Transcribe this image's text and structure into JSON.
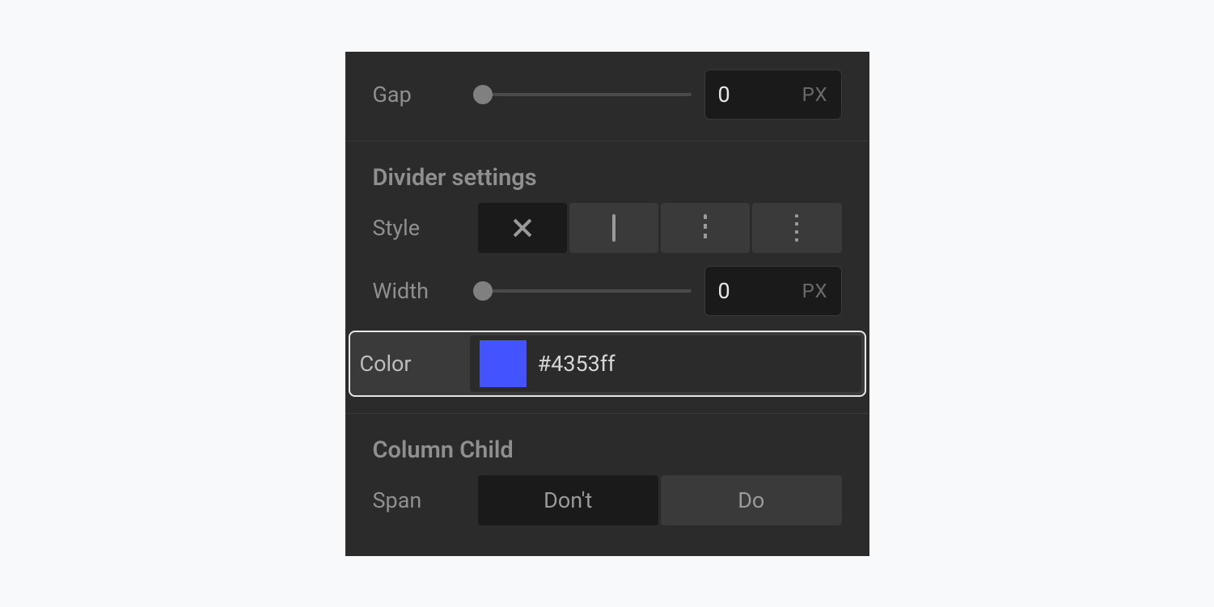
{
  "gap": {
    "label": "Gap",
    "value": "0",
    "unit": "PX"
  },
  "divider": {
    "heading": "Divider settings",
    "style_label": "Style",
    "style_options": [
      "none",
      "solid",
      "dashed",
      "dotted"
    ],
    "style_selected": "none",
    "width_label": "Width",
    "width_value": "0",
    "width_unit": "PX",
    "color_label": "Color",
    "color_hex": "#4353ff"
  },
  "column_child": {
    "heading": "Column Child",
    "span_label": "Span",
    "span_options": {
      "dont": "Don't",
      "do": "Do"
    },
    "span_selected": "dont"
  }
}
